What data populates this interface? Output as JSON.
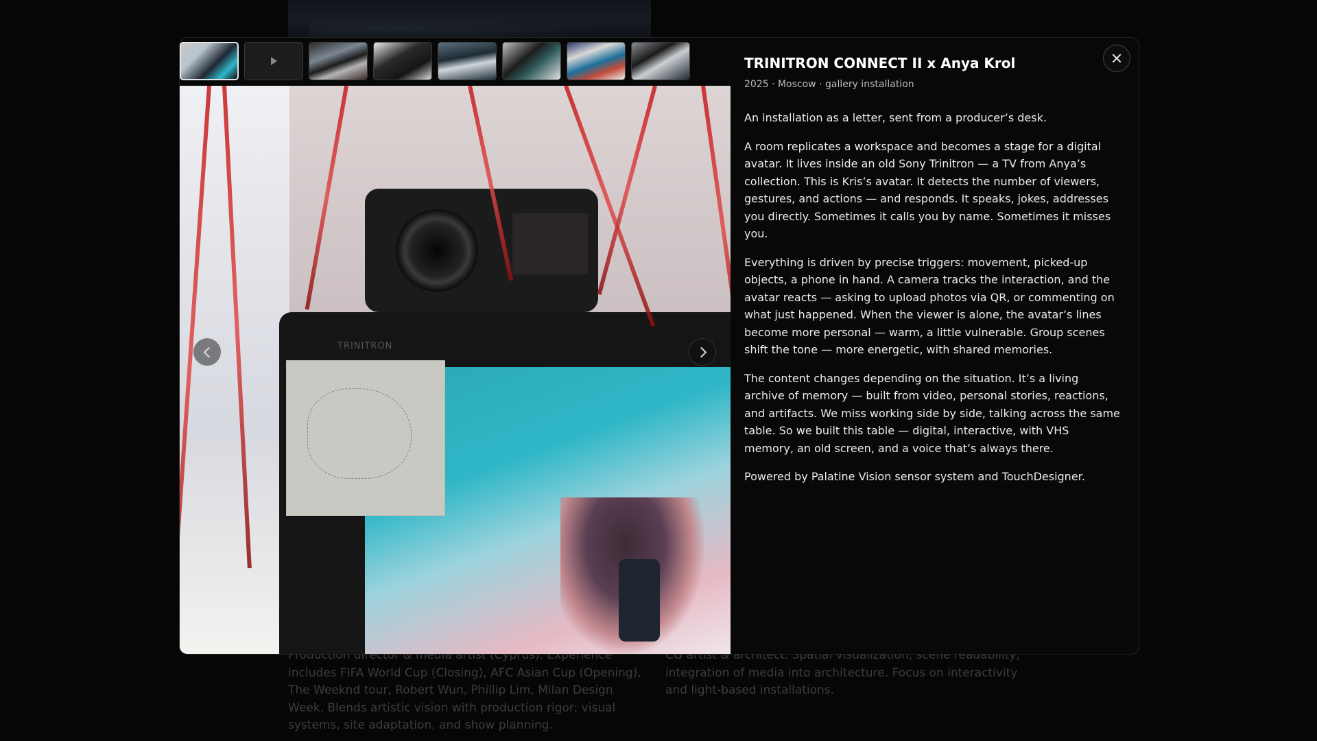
{
  "background": {
    "left_bio": "Production director & media artist (Cyprus). Experience includes FIFA World Cup (Closing), AFC Asian Cup (Opening), The Weeknd tour, Robert Wun, Phillip Lim, Milan Design Week. Blends artistic vision with production rigor: visual systems, site adaptation, and show planning.",
    "right_bio": "CG artist & architect. Spatial visualization, scene readability, integration of media into architecture. Focus on interactivity and light-based installations."
  },
  "gallery": {
    "thumbnails": [
      {
        "type": "image",
        "active": true
      },
      {
        "type": "video",
        "active": false
      },
      {
        "type": "image",
        "active": false
      },
      {
        "type": "image",
        "active": false
      },
      {
        "type": "image",
        "active": false
      },
      {
        "type": "image",
        "active": false
      },
      {
        "type": "image",
        "active": false
      },
      {
        "type": "image",
        "active": false
      }
    ],
    "tv_brand": "TRINITRON"
  },
  "project": {
    "title": "TRINITRON CONNECT II x Anya Krol",
    "meta": "2025 · Moscow · gallery installation",
    "paragraphs": [
      "An installation as a letter, sent from a producer’s desk.",
      "A room replicates a workspace and becomes a stage for a digital avatar. It lives inside an old Sony Trinitron — a TV from Anya’s collection. This is Kris’s avatar. It detects the number of viewers, gestures, and actions — and responds. It speaks, jokes, addresses you directly. Sometimes it calls you by name. Sometimes it misses you.",
      "Everything is driven by precise triggers: movement, picked-up objects, a phone in hand. A camera tracks the interaction, and the avatar reacts — asking to upload photos via QR, or commenting on what just happened. When the viewer is alone, the avatar’s lines become more personal — warm, a little vulnerable. Group scenes shift the tone — more energetic, with shared memories.",
      "The content changes depending on the situation. It’s a living archive of memory — built from video, personal stories, reactions, and artifacts. We miss working side by side, talking across the same table. So we built this table — digital, interactive, with VHS memory, an old screen, and a voice that’s always there.",
      "Powered by Palatine Vision sensor system and TouchDesigner."
    ]
  },
  "icons": {
    "close": "close-icon",
    "prev": "chevron-left-icon",
    "next": "chevron-right-icon",
    "play": "play-icon"
  }
}
